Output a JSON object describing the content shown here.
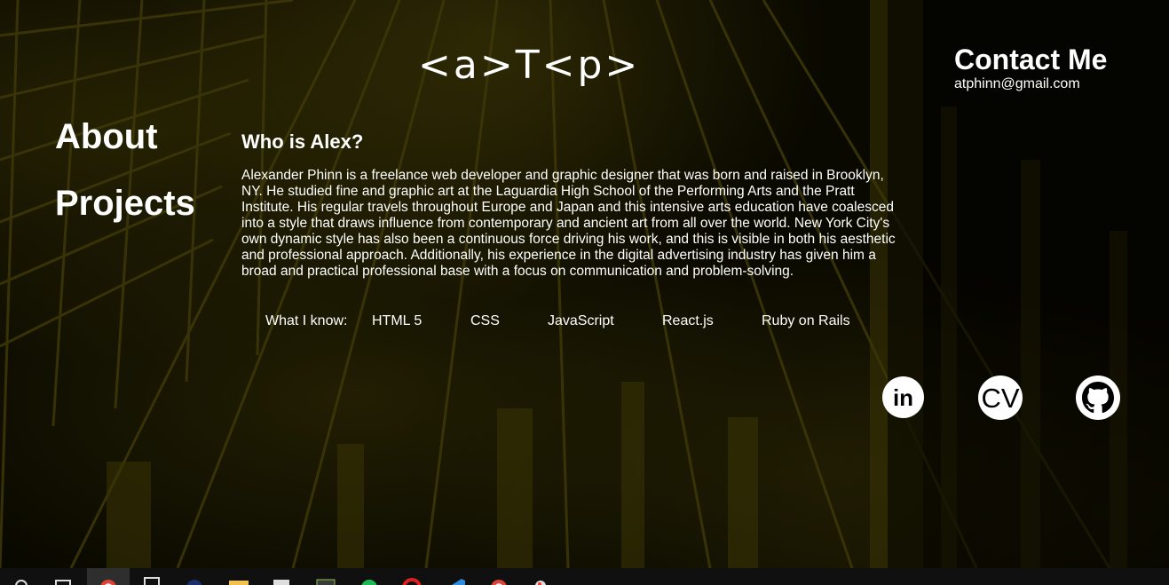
{
  "logo": {
    "text": "<a>T<p>"
  },
  "contact": {
    "title": "Contact Me",
    "email": "atphinn@gmail.com"
  },
  "nav": {
    "about": "About",
    "projects": "Projects"
  },
  "main": {
    "heading": "Who is Alex?",
    "bio": "Alexander Phinn is a freelance web developer and graphic designer that was born and raised in Brooklyn, NY. He studied fine and graphic art at the Laguardia High School of the Performing Arts and the Pratt Institute. His regular travels throughout Europe and Japan and this intensive arts education have coalesced into a style that draws influence from contemporary and ancient art from all over the world. New York City's own dynamic style has also been a continuous force driving his work, and this is visible in both his aesthetic and professional approach. Additionally, his experience in the digital advertising industry has given him a broad and practical professional base with a focus on communication and problem-solving.",
    "skills_label": "What I know:",
    "skills": [
      "HTML 5",
      "CSS",
      "JavaScript",
      "React.js",
      "Ruby on Rails"
    ]
  },
  "social": {
    "linkedin": {
      "icon": "linkedin-icon",
      "text": "in"
    },
    "cv": {
      "icon": "cv-icon",
      "text": "CV"
    },
    "github": {
      "icon": "github-icon"
    }
  },
  "colors": {
    "background": "#070600",
    "texture": "#3a3406",
    "text": "#ffffff",
    "taskbar": "#101010"
  },
  "taskbar": {
    "icons": [
      "search-icon",
      "task-view-icon",
      "chrome-icon",
      "calculator-icon",
      "app-icon",
      "file-explorer-icon",
      "store-icon",
      "terminal-icon",
      "app-green-icon",
      "opera-icon",
      "vscode-icon",
      "chrome-icon",
      "paint-icon"
    ]
  }
}
